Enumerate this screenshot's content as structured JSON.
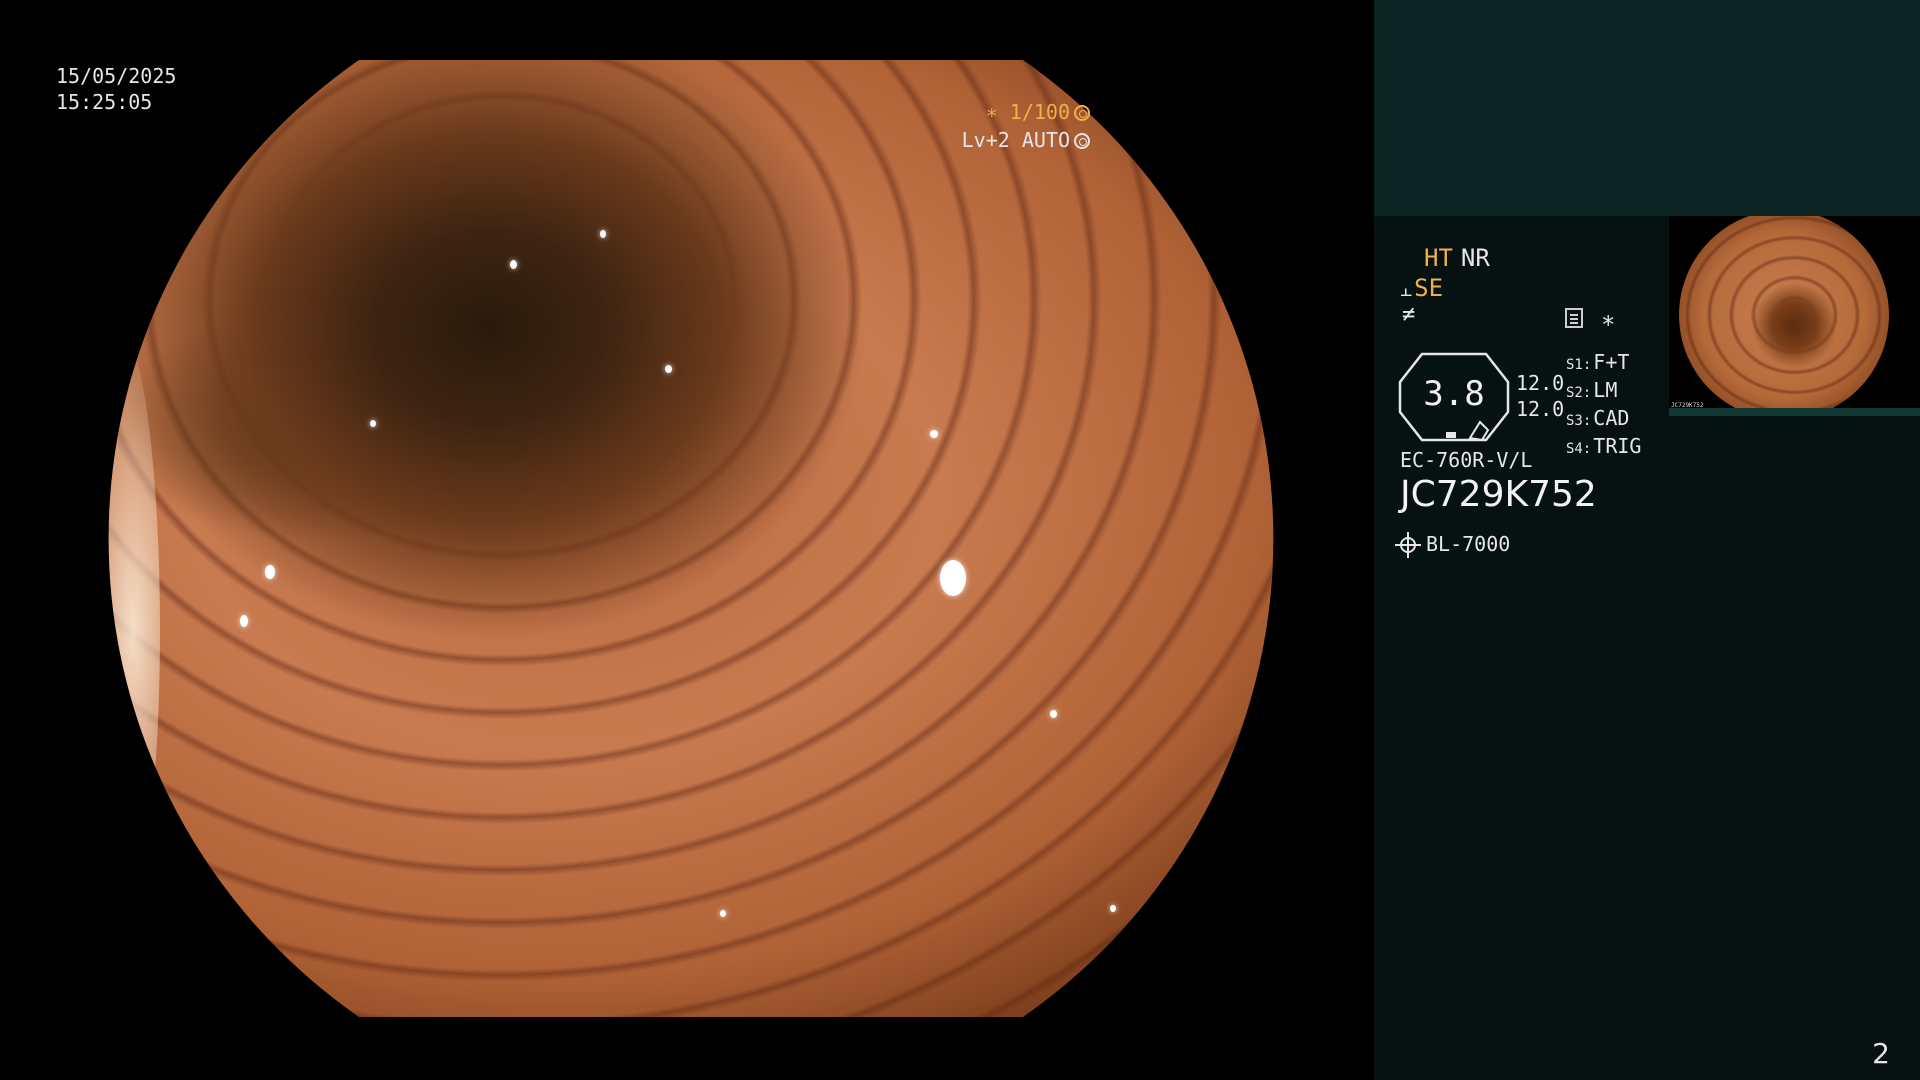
{
  "overlay": {
    "date": "15/05/2025",
    "time": "15:25:05",
    "shutter": "∗ 1/100",
    "level": "Lv+2 AUTO"
  },
  "panel": {
    "ht": "HT",
    "nr": "NR",
    "se": "SE",
    "se_symbol": "⫠",
    "nf_symbol": "≠",
    "star": "∗",
    "zoom_value": "3.8",
    "value_1": "12.0",
    "value_2": "12.0",
    "settings": [
      {
        "key": "S1:",
        "value": "F+T"
      },
      {
        "key": "S2:",
        "value": "LM"
      },
      {
        "key": "S3:",
        "value": "CAD"
      },
      {
        "key": "S4:",
        "value": "TRIG"
      }
    ],
    "scope_model": "EC-760R-V/L",
    "serial": "JC729K752",
    "light_source": "BL-7000",
    "thumbnail_label": "JC729K752"
  },
  "page_number": "2",
  "colors": {
    "accent_orange": "#f1b04a",
    "panel_bg": "#051211",
    "panel_top_bg": "#0b2421",
    "text": "#e6e6e6"
  },
  "icons": [
    "shutter-icon",
    "auto-iris-icon",
    "list-icon",
    "light-icon"
  ]
}
